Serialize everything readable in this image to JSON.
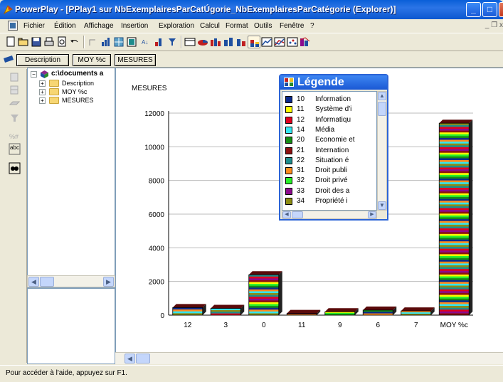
{
  "window": {
    "title": "PowerPlay - [PPlay1 sur NbExemplairesParCatÚgorie_NbExemplairesParCatégorie (Explorer)]",
    "btn_min": "_",
    "btn_max": "□",
    "btn_close": "X"
  },
  "menu": {
    "items": [
      "Fichier",
      "Édition",
      "Affichage",
      "Insertion",
      "Exploration",
      "Calcul",
      "Format",
      "Outils",
      "Fenêtre",
      "?"
    ],
    "mdi_controls": "_ ❐ x"
  },
  "dimension_bar": {
    "items": [
      "Description",
      "MOY %c",
      "MESURES"
    ]
  },
  "tree": {
    "root": "c:\\documents a",
    "children": [
      "Description",
      "MOY %c",
      "MESURES"
    ],
    "expand_symbol": "+",
    "collapse_symbol": "−"
  },
  "vertical_toolbar": {
    "labels": [
      "abc"
    ]
  },
  "chart_data": {
    "type": "bar",
    "stacked": true,
    "ylabel": "MESURES",
    "ylim": [
      0,
      12000
    ],
    "yticks": [
      0,
      2000,
      4000,
      6000,
      8000,
      10000,
      12000
    ],
    "categories": [
      "12",
      "3",
      "0",
      "11",
      "9",
      "6",
      "7",
      "MOY %c"
    ],
    "values": [
      450,
      400,
      2400,
      100,
      200,
      300,
      250,
      11400
    ],
    "grid": true
  },
  "legend": {
    "title": "Légende",
    "position": "top-center",
    "entries": [
      {
        "code": "10",
        "name": "Information",
        "color": "#0a2a8c"
      },
      {
        "code": "11",
        "name": "Système d'i",
        "color": "#ffff00"
      },
      {
        "code": "12",
        "name": "Informatiqu",
        "color": "#e0001e"
      },
      {
        "code": "14",
        "name": "Média",
        "color": "#33e6f0"
      },
      {
        "code": "20",
        "name": "Economie et",
        "color": "#148c14"
      },
      {
        "code": "21",
        "name": "Internation",
        "color": "#8c1010"
      },
      {
        "code": "22",
        "name": "Situation é",
        "color": "#1e8c8c"
      },
      {
        "code": "31",
        "name": "Droit publi",
        "color": "#ff8c1e"
      },
      {
        "code": "32",
        "name": "Droit privé",
        "color": "#28f028"
      },
      {
        "code": "33",
        "name": "Droit des a",
        "color": "#8c0a8c"
      },
      {
        "code": "34",
        "name": "Propriété i",
        "color": "#8c8c14"
      }
    ]
  },
  "status": {
    "text": "Pour accéder à l'aide, appuyez sur F1."
  }
}
